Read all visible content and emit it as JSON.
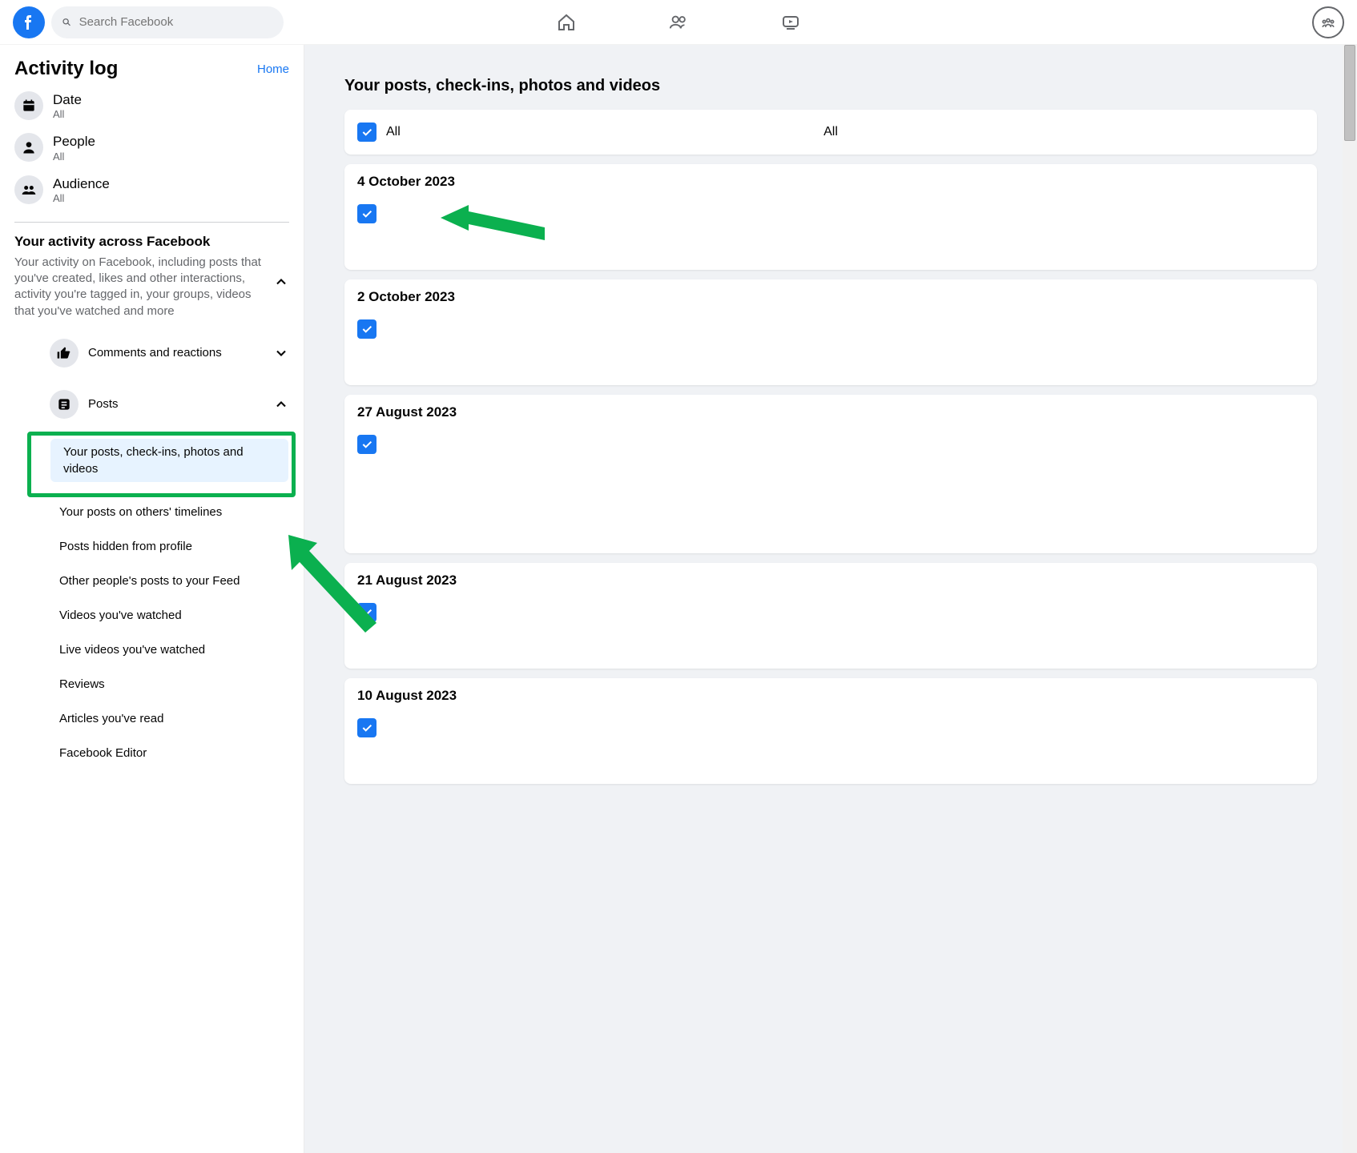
{
  "header": {
    "search_placeholder": "Search Facebook"
  },
  "sidebar": {
    "title": "Activity log",
    "home_link": "Home",
    "filters": [
      {
        "title": "Date",
        "sub": "All"
      },
      {
        "title": "People",
        "sub": "All"
      },
      {
        "title": "Audience",
        "sub": "All"
      }
    ],
    "activity_section": {
      "title": "Your activity across Facebook",
      "desc": "Your activity on Facebook, including posts that you've created, likes and other interactions, activity you're tagged in, your groups, videos that you've watched and more"
    },
    "nav": {
      "comments": "Comments and reactions",
      "posts": "Posts",
      "posts_sub": [
        "Your posts, check-ins, photos and videos",
        "Your posts on others' timelines",
        "Posts hidden from profile",
        "Other people's posts to your Feed",
        "Videos you've watched",
        "Live videos you've watched",
        "Reviews",
        "Articles you've read",
        "Facebook Editor"
      ]
    }
  },
  "main": {
    "title": "Your posts, check-ins, photos and videos",
    "all_left": "All",
    "all_center": "All",
    "entries": [
      {
        "date": "4 October 2023",
        "tall": false
      },
      {
        "date": "2 October 2023",
        "tall": false
      },
      {
        "date": "27 August 2023",
        "tall": true
      },
      {
        "date": "21 August 2023",
        "tall": false
      },
      {
        "date": "10 August 2023",
        "tall": false
      }
    ]
  },
  "colors": {
    "accent": "#1877f2",
    "highlight": "#0bb04f"
  }
}
